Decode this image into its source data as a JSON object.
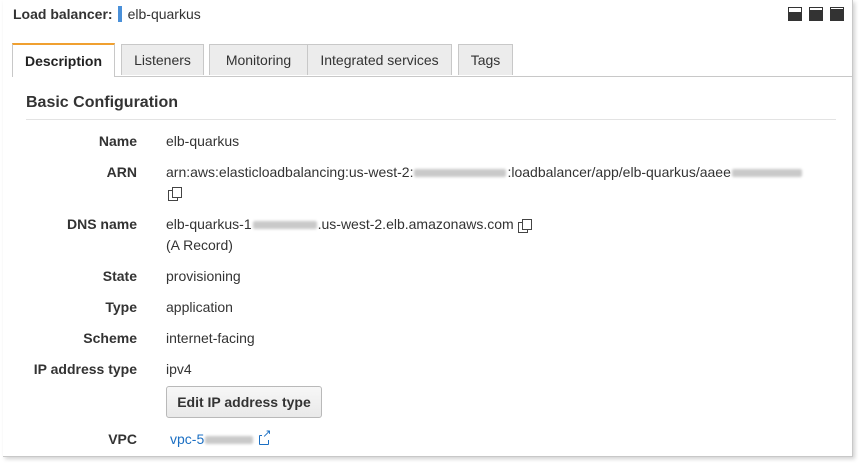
{
  "header": {
    "label": "Load balancer:",
    "name": "elb-quarkus"
  },
  "tabs": [
    {
      "label": "Description",
      "active": true
    },
    {
      "label": "Listeners",
      "active": false
    },
    {
      "label": "Monitoring",
      "active": false
    },
    {
      "label": "Integrated services",
      "active": false
    },
    {
      "label": "Tags",
      "active": false
    }
  ],
  "section": {
    "title": "Basic Configuration"
  },
  "fields": {
    "name": {
      "label": "Name",
      "value": "elb-quarkus"
    },
    "arn": {
      "label": "ARN",
      "prefix": "arn:aws:elasticloadbalancing:us-west-2:",
      "suffix": ":loadbalancer/app/elb-quarkus/aaee"
    },
    "dns": {
      "label": "DNS name",
      "prefix": "elb-quarkus-1",
      "suffix": ".us-west-2.elb.amazonaws.com",
      "note": "(A Record)"
    },
    "state": {
      "label": "State",
      "value": "provisioning"
    },
    "type": {
      "label": "Type",
      "value": "application"
    },
    "scheme": {
      "label": "Scheme",
      "value": "internet-facing"
    },
    "ip_type": {
      "label": "IP address type",
      "value": "ipv4"
    },
    "vpc": {
      "label": "VPC",
      "value": "vpc-5"
    }
  },
  "edit_button": {
    "label": "Edit IP address type"
  },
  "icons": [
    "minimize-icon",
    "split-view-icon",
    "maximize-icon",
    "copy-icon",
    "external-link-icon"
  ],
  "colors": {
    "active_tab_accent": "#f0a030",
    "link": "#1b6fc3",
    "header_marker": "#4a90d9"
  }
}
